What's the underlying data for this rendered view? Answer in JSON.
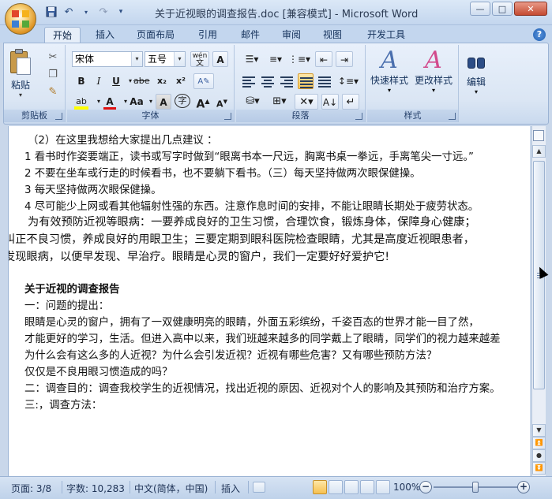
{
  "window": {
    "title": "关于近视眼的调查报告.doc [兼容模式] - Microsoft Word",
    "minimize": "—",
    "maximize": "□",
    "close": "✕"
  },
  "qat": {
    "save_icon": "save-icon",
    "undo_icon": "undo-icon",
    "redo_icon": "redo-icon",
    "more_icon": "customize-qat-icon"
  },
  "tabs": [
    "开始",
    "插入",
    "页面布局",
    "引用",
    "邮件",
    "审阅",
    "视图",
    "开发工具"
  ],
  "ribbon": {
    "clipboard": {
      "label": "剪贴板",
      "paste": "粘贴"
    },
    "font": {
      "label": "字体",
      "font_name": "宋体",
      "font_size": "五号",
      "wen": "wén",
      "bold": "B",
      "italic": "I",
      "underline": "U",
      "strike": "abe",
      "subscript": "x₂",
      "superscript": "x²",
      "case": "Aa",
      "grow": "A",
      "shrink": "A",
      "charshade": "A",
      "enclose": "字",
      "charborder": "A"
    },
    "paragraph": {
      "label": "段落"
    },
    "styles": {
      "label": "样式",
      "quick": "快速样式",
      "change": "更改样式"
    },
    "editing": {
      "label": "编辑",
      "edit": "编辑"
    }
  },
  "document": {
    "lines": [
      "（2）在这里我想给大家提出几点建议 ：",
      "1 看书时作姿要端正，读书或写字时做到“眼离书本一尺远，胸离书桌一拳远，手离笔尖一寸远。”",
      "2 不要在坐车或行走的时候看书，也不要躺下看书。（三）每天坚持做两次眼保健操。",
      "3 每天坚持做两次眼保健操。",
      "4 尽可能少上网或看其他辐射性强的东西。注意作息时间的安排，不能让眼睛长期处于疲劳状态。",
      "为有效预防近视等眼病：一要养成良好的卫生习惯，合理饮食，锻炼身体，保障身心健康；",
      "纠正不良习惯，养成良好的用眼卫生；三要定期到眼科医院检查眼睛，尤其是高度近视眼患者，",
      "发现眼病，以便早发现、早治疗。眼睛是心灵的窗户，我们一定要好好爱护它!",
      "关于近视的调查报告",
      "一：问题的提出：",
      "眼睛是心灵的窗户，拥有了一双健康明亮的眼睛，外面五彩缤纷，千姿百态的世界才能一目了然，",
      "才能更好的学习，生活。但进入高中以来，我们班越来越多的同学戴上了眼睛，同学们的视力越来越差",
      "为什么会有这么多的人近视？为什么会引发近视？近视有哪些危害？又有哪些预防方法？",
      "仅仅是不良用眼习惯造成的吗？",
      "二：调查目的：调查我校学生的近视情况，找出近视的原因、近视对个人的影响及其预防和治疗方案。",
      "三:，调查方法："
    ]
  },
  "status": {
    "page": "页面: 3/8",
    "words": "字数: 10,283",
    "lang": "中文(简体，中国)",
    "mode": "插入",
    "zoom": "100%",
    "zoom_minus": "−",
    "zoom_plus": "+"
  }
}
